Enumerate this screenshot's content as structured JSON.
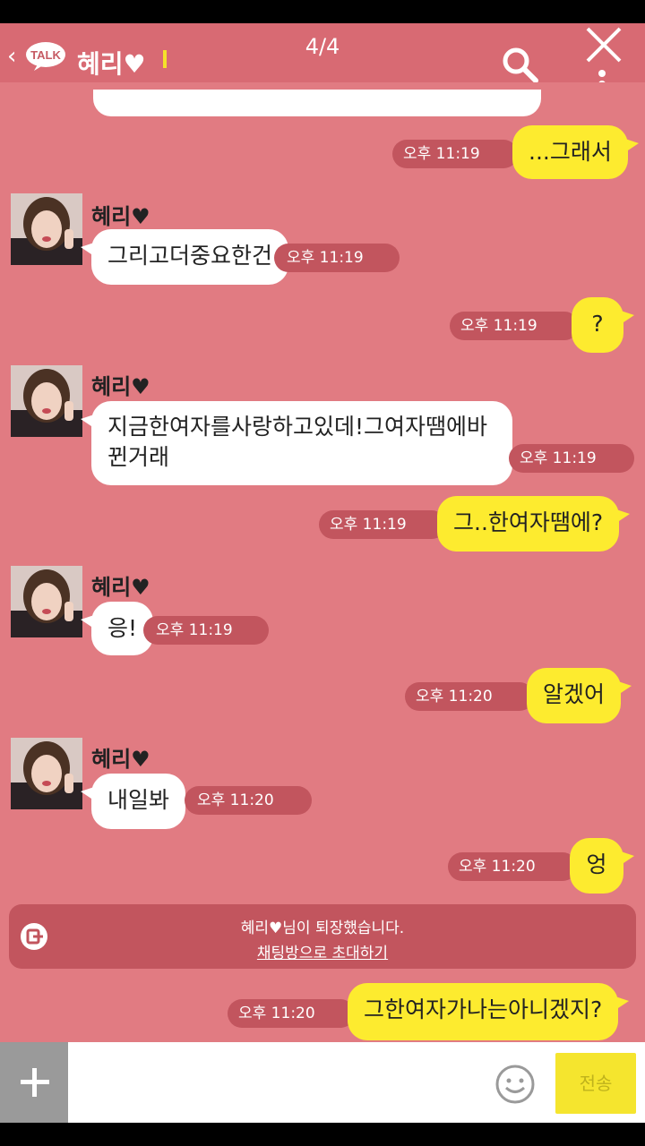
{
  "header": {
    "back_glyph": "‹",
    "logo_text": "TALK",
    "title": "혜리♥",
    "page_counter": "4/4",
    "search_icon": "search-icon",
    "close_icon": "close-icon",
    "menu_icon": "kebab-menu-icon"
  },
  "messages": [
    {
      "side": "out",
      "text": "...그래서",
      "time": "오후 11:19"
    },
    {
      "side": "in",
      "sender": "혜리♥",
      "text": "그리고더중요한건",
      "time": "오후 11:19"
    },
    {
      "side": "out",
      "text": "?",
      "time": "오후 11:19"
    },
    {
      "side": "in",
      "sender": "혜리♥",
      "text": "지금한여자를사랑하고있데!그여자땜에바뀐거래",
      "time": "오후 11:19"
    },
    {
      "side": "out",
      "text": "그..한여자땜에?",
      "time": "오후 11:19"
    },
    {
      "side": "in",
      "sender": "혜리♥",
      "text": "응!",
      "time": "오후 11:19"
    },
    {
      "side": "out",
      "text": "알겠어",
      "time": "오후 11:20"
    },
    {
      "side": "in",
      "sender": "혜리♥",
      "text": "내일봐",
      "time": "오후 11:20"
    },
    {
      "side": "out",
      "text": "엉",
      "time": "오후 11:20"
    },
    {
      "side": "out",
      "text": "그한여자가나는아니겠지?",
      "time": "오후 11:20"
    }
  ],
  "notice": {
    "text": "혜리♥님이 퇴장했습니다.",
    "link": "채팅방으로 초대하기",
    "icon": "exit-icon"
  },
  "composer": {
    "placeholder": "",
    "send_label": "전송",
    "plus_icon": "plus-icon",
    "emoji_icon": "emoji-icon"
  },
  "colors": {
    "chat_bg": "#e17b82",
    "header_bg": "#d86a73",
    "bubble_out": "#fdeb2f",
    "bubble_in": "#ffffff",
    "time_pill": "#c2555e"
  }
}
